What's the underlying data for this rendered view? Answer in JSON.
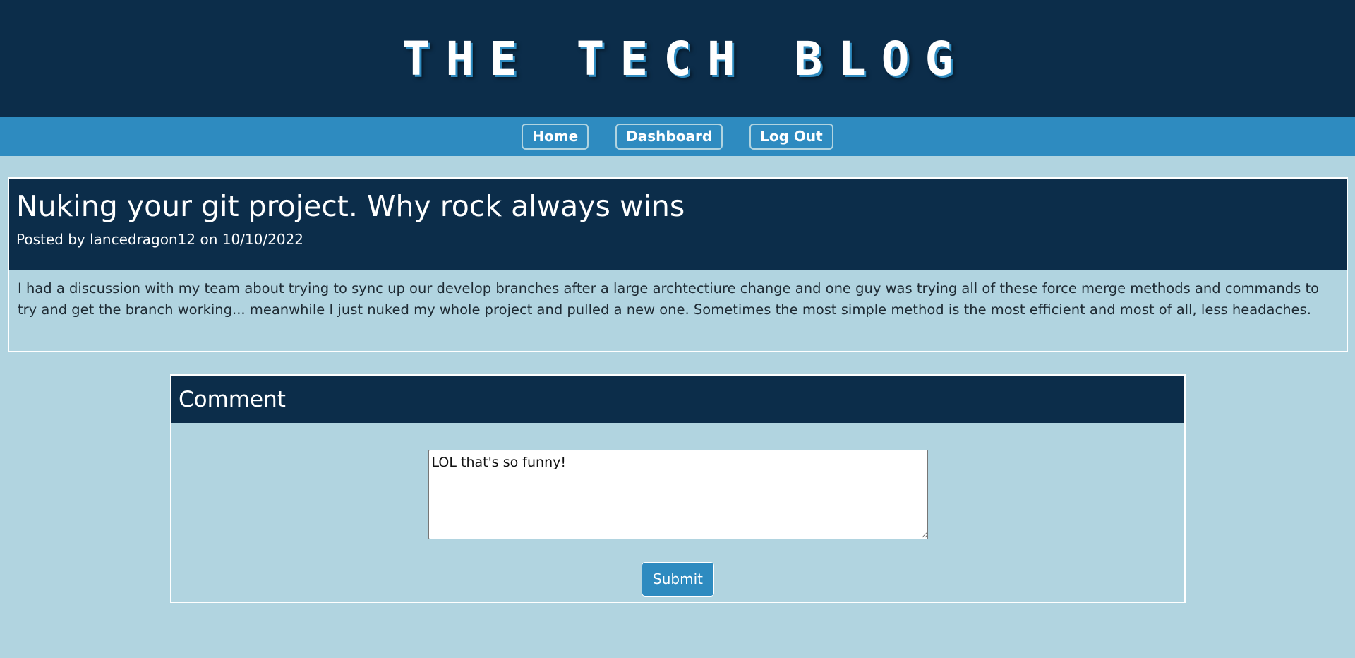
{
  "header": {
    "title": "THE TECH BLOG"
  },
  "nav": {
    "home_label": "Home",
    "dashboard_label": "Dashboard",
    "logout_label": "Log Out"
  },
  "post": {
    "title": "Nuking your git project. Why rock always wins",
    "meta": "Posted by lancedragon12 on 10/10/2022",
    "body": "I had a discussion with my team about trying to sync up our develop branches after a large archtectiure change and one guy was trying all of these force merge methods and commands to try and get the branch working... meanwhile I just nuked my whole project and pulled a new one. Sometimes the most simple method is the most efficient and most of all, less headaches."
  },
  "comment": {
    "title": "Comment",
    "textarea_value": "LOL that's so funny!",
    "submit_label": "Submit"
  },
  "colors": {
    "page_background": "#b1d4e0",
    "header_background": "#0c2d4a",
    "nav_background": "#2e8bc0",
    "accent": "#2e8bc0"
  }
}
